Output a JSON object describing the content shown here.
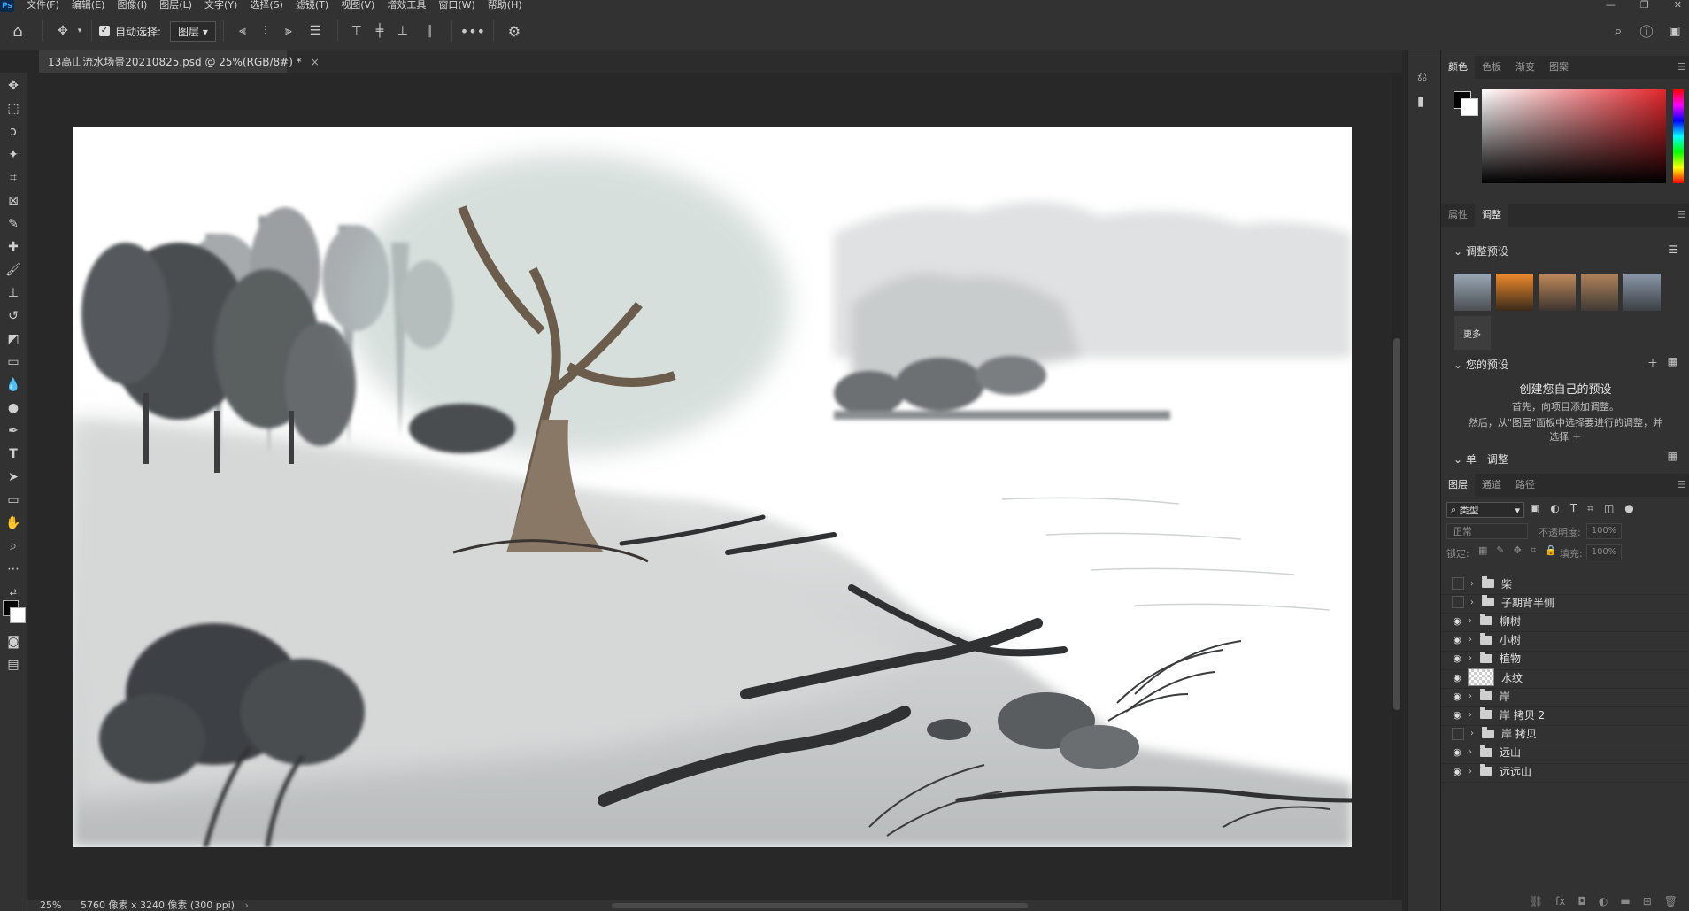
{
  "menu": {
    "items": [
      "文件(F)",
      "编辑(E)",
      "图像(I)",
      "图层(L)",
      "文字(Y)",
      "选择(S)",
      "滤镜(T)",
      "视图(V)",
      "增效工具",
      "窗口(W)",
      "帮助(H)"
    ]
  },
  "options": {
    "auto_select_label": "自动选择:",
    "auto_select_target": "图层"
  },
  "document": {
    "tab_title": "13高山流水场景20210825.psd @ 25%(RGB/8#) *",
    "close": "×"
  },
  "status": {
    "zoom": "25%",
    "dimensions": "5760 像素 x 3240 像素 (300 ppi)"
  },
  "color_panel": {
    "tabs": [
      "颜色",
      "色板",
      "渐变",
      "图案"
    ],
    "accent": "#e1252b"
  },
  "adjust_panel": {
    "tabs": [
      "属性",
      "调整"
    ],
    "presets_title": "调整预设",
    "more_label": "更多",
    "your_presets_title": "您的预设",
    "create_title": "创建您自己的预设",
    "create_desc1": "首先，向项目添加调整。",
    "create_desc2": "然后，从\"图层\"面板中选择要进行的调整，并",
    "create_desc3": "选择 ＋",
    "single_title": "单一调整"
  },
  "layers_panel": {
    "tabs": [
      "图层",
      "通道",
      "路径"
    ],
    "filter_label": "类型",
    "blend_mode": "正常",
    "opacity_label": "不透明度:",
    "opacity_value": "100%",
    "lock_label": "锁定:",
    "fill_label": "填充:",
    "fill_value": "100%",
    "layers": [
      {
        "name": "柴",
        "visible": false,
        "type": "folder"
      },
      {
        "name": "子期背半侧",
        "visible": false,
        "type": "folder"
      },
      {
        "name": "柳树",
        "visible": true,
        "type": "folder"
      },
      {
        "name": "小树",
        "visible": true,
        "type": "folder"
      },
      {
        "name": "植物",
        "visible": true,
        "type": "folder"
      },
      {
        "name": "水纹",
        "visible": true,
        "type": "pixel"
      },
      {
        "name": "岸",
        "visible": true,
        "type": "folder"
      },
      {
        "name": "岸 拷贝 2",
        "visible": true,
        "type": "folder"
      },
      {
        "name": "岸 拷贝",
        "visible": false,
        "type": "folder"
      },
      {
        "name": "远山",
        "visible": true,
        "type": "folder"
      },
      {
        "name": "远远山",
        "visible": true,
        "type": "folder"
      }
    ]
  }
}
